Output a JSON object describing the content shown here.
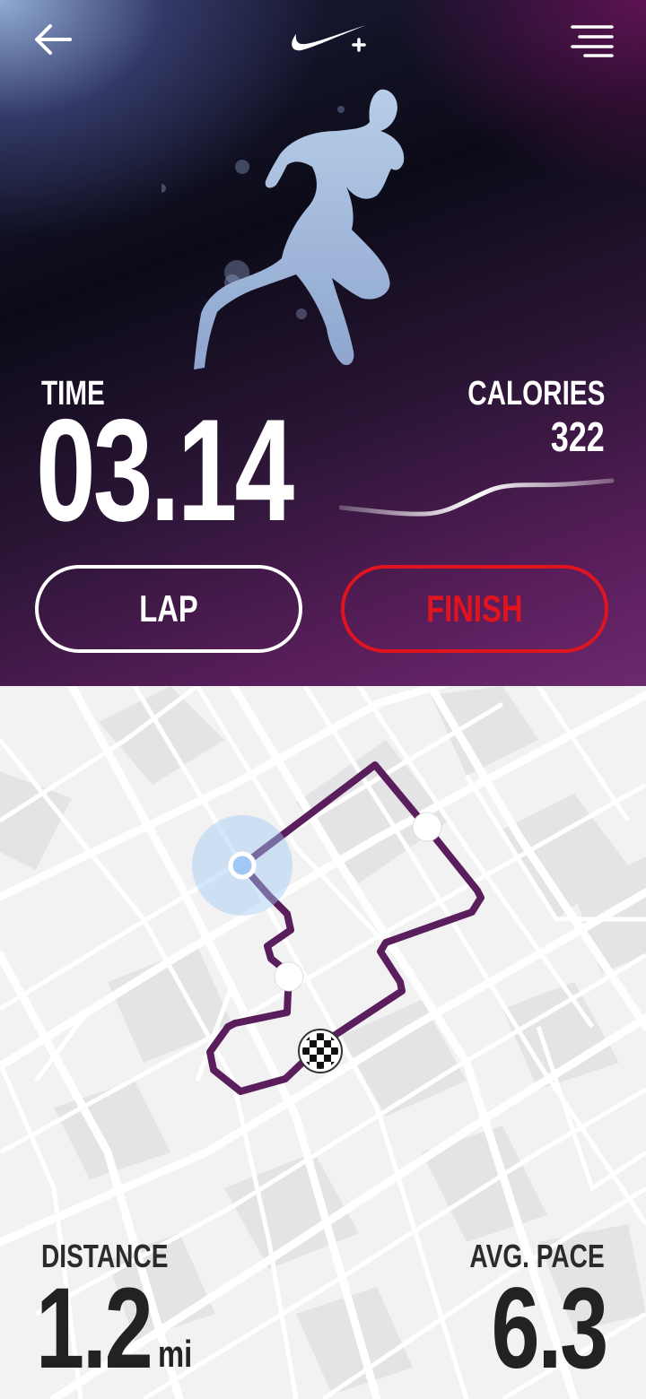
{
  "header": {
    "back_icon": "arrow-left-icon",
    "logo_icon": "swoosh-plus-logo",
    "menu_icon": "hamburger-menu-icon"
  },
  "workout": {
    "time_label": "TIME",
    "time_value": "03.14",
    "calories_label": "CALORIES",
    "calories_value": "322"
  },
  "actions": {
    "lap_label": "LAP",
    "finish_label": "FINISH"
  },
  "stats": {
    "distance_label": "DISTANCE",
    "distance_value": "1.2",
    "distance_unit": "mi",
    "pace_label": "AVG. PACE",
    "pace_value": "6.3"
  },
  "colors": {
    "accent_finish": "#e0141e",
    "route": "#5a1e5c",
    "current_location": "#9fc8f5",
    "map_background": "#f2f2f3"
  }
}
